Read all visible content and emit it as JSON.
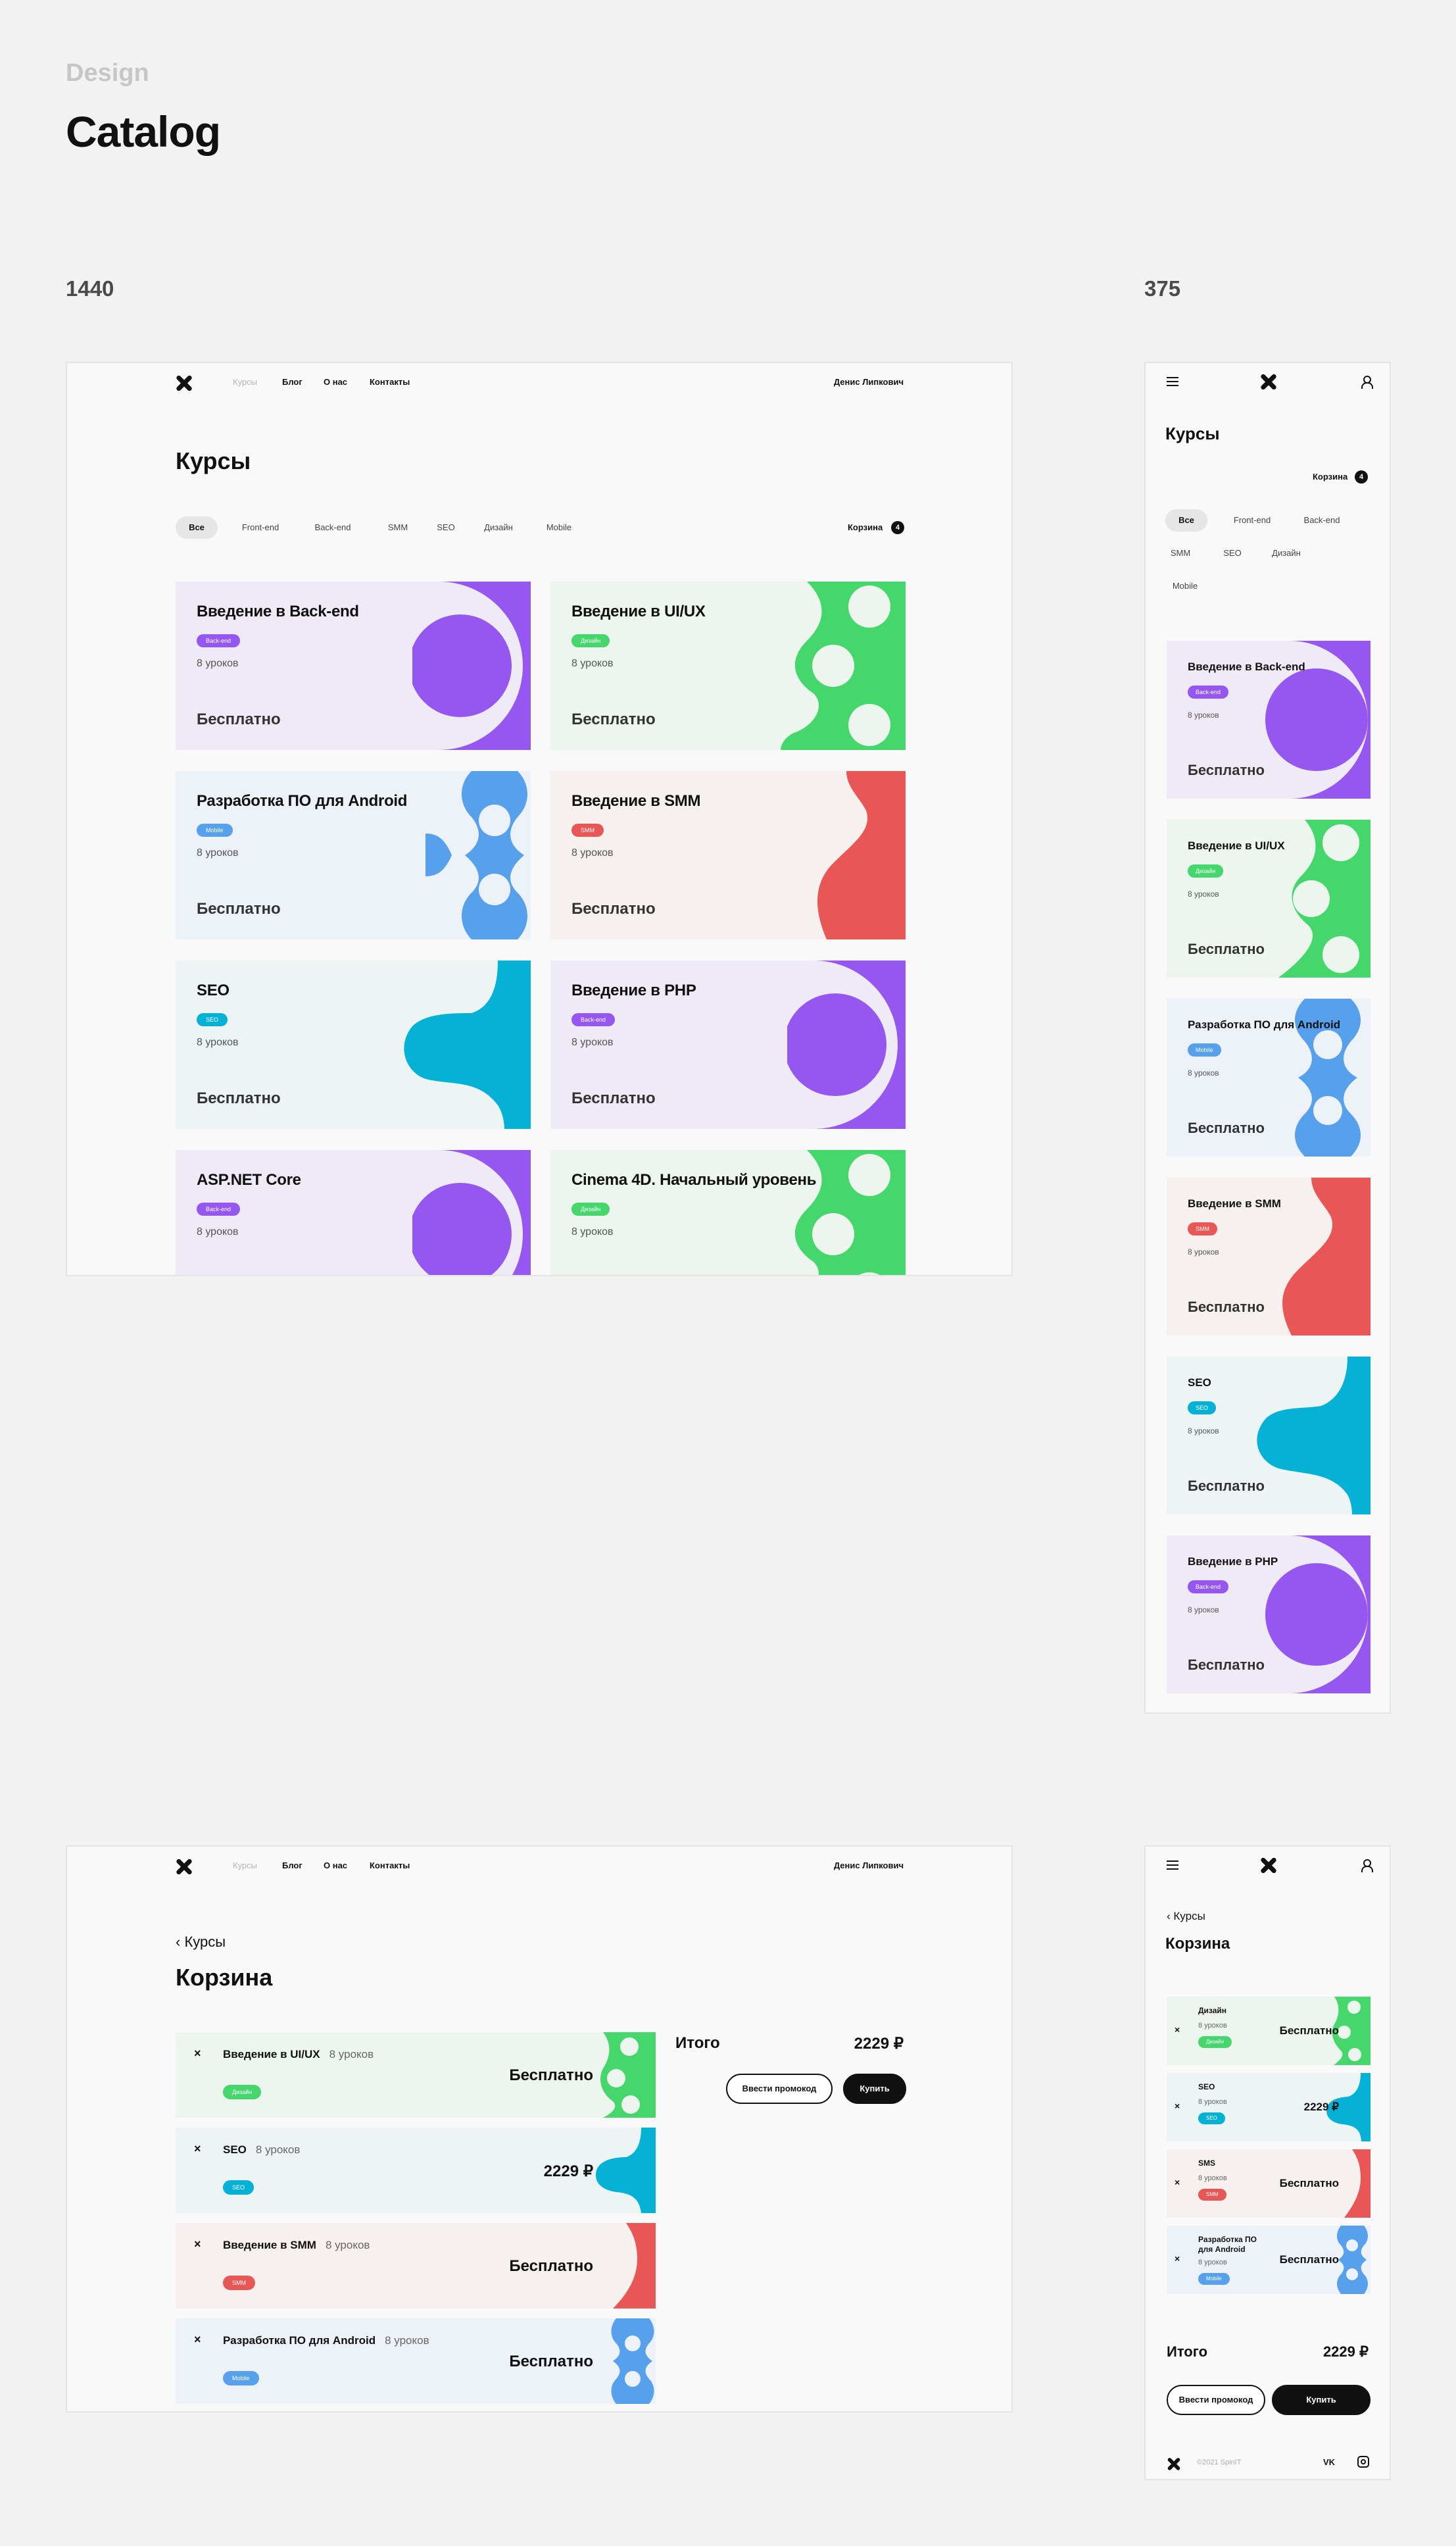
{
  "header": {
    "section": "Design",
    "title": "Catalog"
  },
  "sizes": {
    "desktop": "1440",
    "mobile": "375"
  },
  "nav": {
    "courses": "Курсы",
    "blog": "Блог",
    "about": "О нас",
    "contacts": "Контакты",
    "user": "Денис Липкович"
  },
  "catalog": {
    "title": "Курсы",
    "filters": [
      "Все",
      "Front-end",
      "Back-end",
      "SMM",
      "SEO",
      "Дизайн",
      "Mobile"
    ],
    "cart_label": "Корзина",
    "cart_count": "4",
    "cards": [
      {
        "title": "Введение в Back-end",
        "tag": "Back-end",
        "lessons": "8 уроков",
        "price": "Бесплатно"
      },
      {
        "title": "Введение в UI/UX",
        "tag": "Дизайн",
        "lessons": "8 уроков",
        "price": "Бесплатно"
      },
      {
        "title": "Разработка ПО для Android",
        "tag": "Mobile",
        "lessons": "8 уроков",
        "price": "Бесплатно"
      },
      {
        "title": "Введение в SMM",
        "tag": "SMM",
        "lessons": "8 уроков",
        "price": "Бесплатно"
      },
      {
        "title": "SEO",
        "tag": "SEO",
        "lessons": "8 уроков",
        "price": "Бесплатно"
      },
      {
        "title": "Введение в PHP",
        "tag": "Back-end",
        "lessons": "8 уроков",
        "price": "Бесплатно"
      },
      {
        "title": "ASP.NET Core",
        "tag": "Back-end",
        "lessons": "8 уроков",
        "price": ""
      },
      {
        "title": "Cinema 4D. Начальный уровень",
        "tag": "Дизайн",
        "lessons": "8 уроков",
        "price": ""
      }
    ]
  },
  "cart": {
    "back": "Курсы",
    "title": "Корзина",
    "total_label": "Итого",
    "total_value": "2229 ₽",
    "promo_button": "Ввести промокод",
    "buy_button": "Купить",
    "items": [
      {
        "title": "Введение в UI/UX",
        "lessons": "8 уроков",
        "tag": "Дизайн",
        "price": "Бесплатно"
      },
      {
        "title": "SEO",
        "lessons": "8 уроков",
        "tag": "SEO",
        "price": "2229 ₽"
      },
      {
        "title": "Введение в SMM",
        "lessons": "8 уроков",
        "tag": "SMM",
        "price": "Бесплатно"
      },
      {
        "title": "Разработка ПО для Android",
        "lessons": "8 уроков",
        "tag": "Mobile",
        "price": "Бесплатно"
      }
    ],
    "mobile_items": [
      {
        "title": "Дизайн",
        "lessons": "8 уроков",
        "tag": "Дизайн",
        "price": "Бесплатно"
      },
      {
        "title": "SEO",
        "lessons": "8 уроков",
        "tag": "SEO",
        "price": "2229 ₽"
      },
      {
        "title": "SMS",
        "lessons": "8 уроков",
        "tag": "SMM",
        "price": "Бесплатно"
      },
      {
        "title": "Разработка ПО для Android",
        "lessons": "8 уроков",
        "tag": "Mobile",
        "price": "Бесплатно"
      }
    ]
  },
  "footer": {
    "copyright": "©2021 SpinIT",
    "vk": "VK"
  },
  "colors": {
    "purple": "#9557f0",
    "green": "#45d66c",
    "blue": "#57a1ec",
    "red": "#e85656",
    "cyan": "#06b1d6"
  }
}
